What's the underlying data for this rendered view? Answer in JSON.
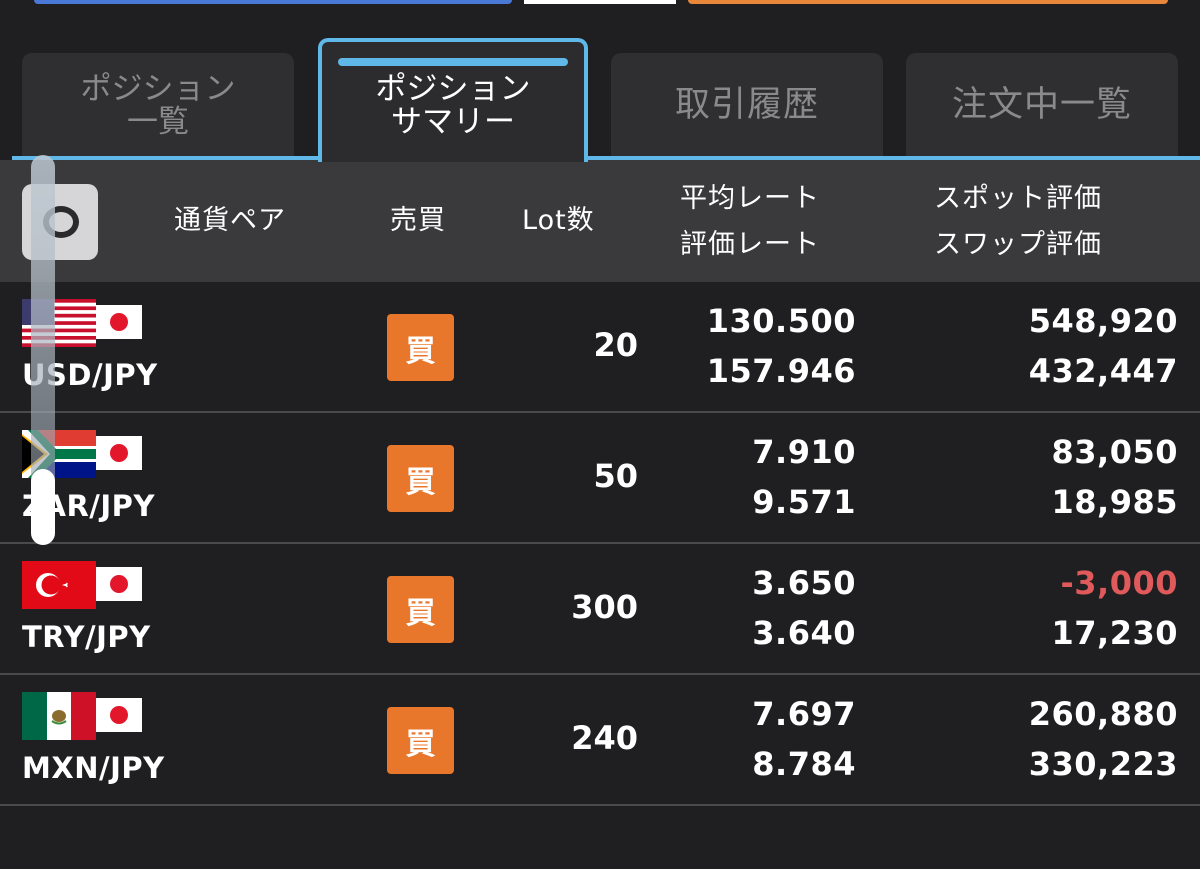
{
  "tabs": [
    {
      "label": "ポジション\n一覧",
      "active": false
    },
    {
      "label": "ポジション\nサマリー",
      "active": true
    },
    {
      "label": "取引履歴",
      "active": false
    },
    {
      "label": "注文中一覧",
      "active": false
    }
  ],
  "header": {
    "filter_icon": "filter-ring-icon",
    "pair": "通貨ペア",
    "side": "売買",
    "lot": "Lot数",
    "avg_rate": "平均レート",
    "eval_rate": "評価レート",
    "spot_eval": "スポット評価",
    "swap_eval": "スワップ評価"
  },
  "rows": [
    {
      "pair": "USD/JPY",
      "base_flag": "us-flag-icon",
      "quote_flag": "jp-flag-icon",
      "side": "買",
      "lot": "20",
      "avg_rate": "130.500",
      "eval_rate": "157.946",
      "spot_eval": "548,920",
      "swap_eval": "432,447"
    },
    {
      "pair": "ZAR/JPY",
      "base_flag": "za-flag-icon",
      "quote_flag": "jp-flag-icon",
      "side": "買",
      "lot": "50",
      "avg_rate": "7.910",
      "eval_rate": "9.571",
      "spot_eval": "83,050",
      "swap_eval": "18,985"
    },
    {
      "pair": "TRY/JPY",
      "base_flag": "tr-flag-icon",
      "quote_flag": "jp-flag-icon",
      "side": "買",
      "lot": "300",
      "avg_rate": "3.650",
      "eval_rate": "3.640",
      "spot_eval": "-3,000",
      "swap_eval": "17,230"
    },
    {
      "pair": "MXN/JPY",
      "base_flag": "mx-flag-icon",
      "quote_flag": "jp-flag-icon",
      "side": "買",
      "lot": "240",
      "avg_rate": "7.697",
      "eval_rate": "8.784",
      "spot_eval": "260,880",
      "swap_eval": "330,223"
    }
  ],
  "colors": {
    "background": "#1f1f21",
    "accent_blue": "#5fb8e8",
    "buy_badge": "#e8772c",
    "negative": "#e0595b"
  }
}
